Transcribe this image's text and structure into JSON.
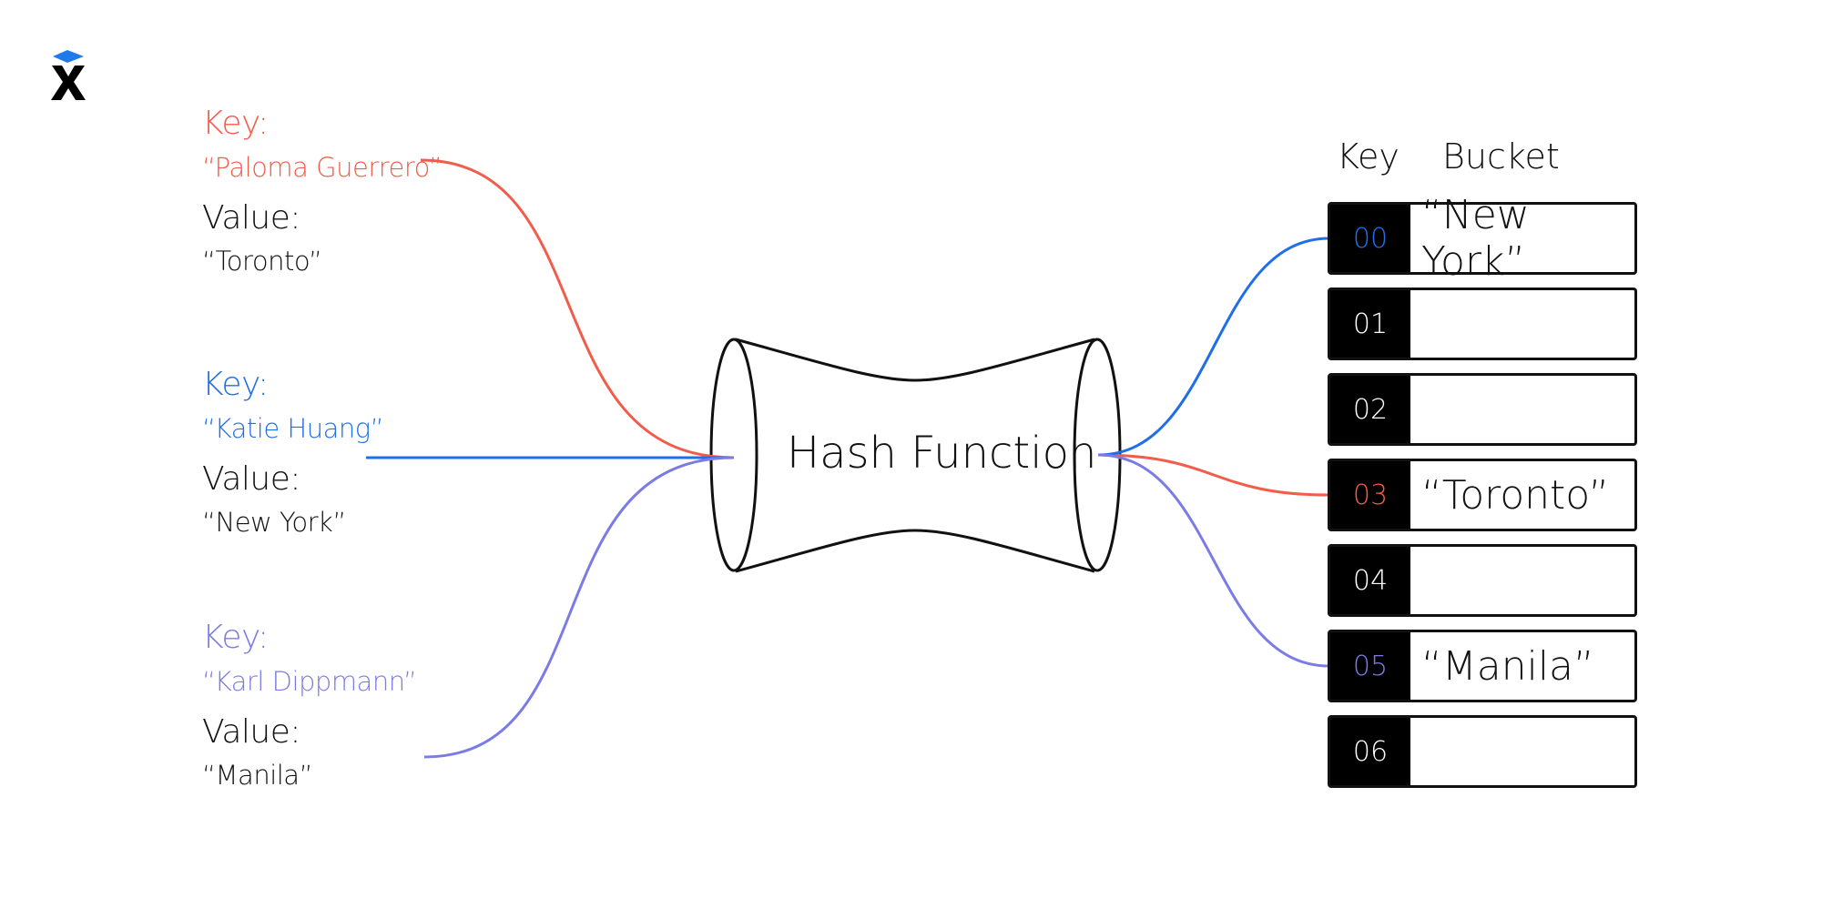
{
  "colors": {
    "red": "#f25c4a",
    "blue": "#1f6fe8",
    "purple": "#7b7be6",
    "ink": "#111111",
    "logo_blue": "#1f7aec"
  },
  "logo": {
    "icon": "x-logo-icon"
  },
  "entries": [
    {
      "key_label": "Key:",
      "key": "“Paloma Guerrero”",
      "value_label": "Value:",
      "value": "“Toronto”",
      "color": "red",
      "bucket_index": 3
    },
    {
      "key_label": "Key:",
      "key": "“Katie Huang”",
      "value_label": "Value:",
      "value": "“New York”",
      "color": "blue",
      "bucket_index": 0
    },
    {
      "key_label": "Key:",
      "key": "“Karl Dippmann”",
      "value_label": "Value:",
      "value": "“Manila”",
      "color": "purple",
      "bucket_index": 5
    }
  ],
  "hash_function": {
    "label": "Hash Function"
  },
  "table": {
    "key_header": "Key",
    "bucket_header": "Bucket",
    "rows": [
      {
        "key": "00",
        "bucket": "“New York”",
        "key_color": "blue"
      },
      {
        "key": "01",
        "bucket": "",
        "key_color": null
      },
      {
        "key": "02",
        "bucket": "",
        "key_color": null
      },
      {
        "key": "03",
        "bucket": "“Toronto”",
        "key_color": "red"
      },
      {
        "key": "04",
        "bucket": "",
        "key_color": null
      },
      {
        "key": "05",
        "bucket": "“Manila”",
        "key_color": "purple"
      },
      {
        "key": "06",
        "bucket": "",
        "key_color": null
      }
    ]
  }
}
